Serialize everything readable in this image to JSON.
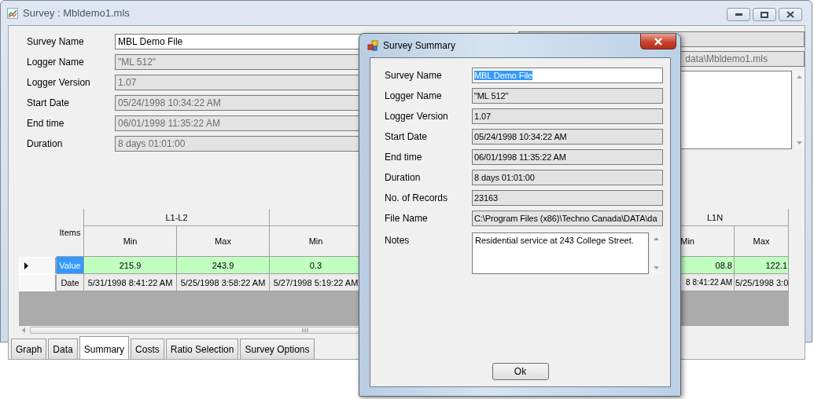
{
  "window": {
    "title": "Survey : Mbldemo1.mls"
  },
  "form": {
    "fields": [
      {
        "label": "Survey Name",
        "value": "MBL Demo File",
        "kind": "input",
        "disabled": false
      },
      {
        "label": "Logger Name",
        "value": "\"ML 512\"",
        "kind": "readonly",
        "disabled": true
      },
      {
        "label": "Logger Version",
        "value": "1.07",
        "kind": "readonly",
        "disabled": true
      },
      {
        "label": "Start Date",
        "value": "05/24/1998  10:34:22 AM",
        "kind": "readonly",
        "disabled": true
      },
      {
        "label": "End time",
        "value": "06/01/1998  11:35:22 AM",
        "kind": "readonly",
        "disabled": true
      },
      {
        "label": "Duration",
        "value": "8 days 01:01:00",
        "kind": "readonly",
        "disabled": true
      }
    ]
  },
  "side_fields": [
    {
      "kind": "readonly"
    },
    {
      "kind": "readonly",
      "value": "data\\Mbldemo1.mls",
      "disabled": true
    },
    {
      "kind": "memo",
      "disabled": false
    }
  ],
  "grid": {
    "items_header": "Items",
    "groups": [
      {
        "label": "L1-L2",
        "columns": [
          "Min",
          "Max"
        ]
      },
      {
        "columns": [
          "Min"
        ]
      },
      {
        "label": "L1N",
        "columns": [
          "Min",
          "Max"
        ]
      }
    ],
    "rows": [
      {
        "label": "Value",
        "selected": true,
        "cells": [
          "215.9",
          "243.9",
          "0.3",
          "08.8",
          "122.1"
        ]
      },
      {
        "label": "Date",
        "selected": false,
        "cells": [
          "5/31/1998 8:41:22 AM",
          "5/25/1998 3:58:22 AM",
          "5/27/1998 5:19:22 AM",
          "8 8:41:22 AM",
          "5/25/1998 3:0"
        ]
      }
    ]
  },
  "tabs": [
    {
      "label": "Graph",
      "selected": false
    },
    {
      "label": "Data",
      "selected": false
    },
    {
      "label": "Summary",
      "selected": true
    },
    {
      "label": "Costs",
      "selected": false
    },
    {
      "label": "Ratio Selection",
      "selected": false
    },
    {
      "label": "Survey Options",
      "selected": false
    }
  ],
  "dialog": {
    "title": "Survey Summary",
    "fields": [
      {
        "label": "Survey Name",
        "value": "MBL Demo File",
        "kind": "input",
        "text_selected": true,
        "disabled": false
      },
      {
        "label": "Logger Name",
        "value": "\"ML 512\"",
        "kind": "readonly",
        "disabled": false
      },
      {
        "label": "Logger Version",
        "value": "1.07",
        "kind": "readonly",
        "disabled": false
      },
      {
        "label": "Start Date",
        "value": "05/24/1998  10:34:22 AM",
        "kind": "readonly",
        "disabled": false
      },
      {
        "label": "End time",
        "value": "06/01/1998  11:35:22 AM",
        "kind": "readonly",
        "disabled": false
      },
      {
        "label": "Duration",
        "value": "8 days 01:01:00",
        "kind": "readonly",
        "disabled": false
      },
      {
        "label": "No. of Records",
        "value": "23163",
        "kind": "readonly",
        "disabled": false
      },
      {
        "label": "File Name",
        "value": "C:\\Program Files (x86)\\Techno Canada\\DATA\\da",
        "kind": "readonly",
        "disabled": false
      },
      {
        "label": "Notes",
        "value": "Residential service at 243 College Street.",
        "kind": "memo",
        "disabled": false
      }
    ],
    "buttons": [
      "Ok"
    ]
  }
}
